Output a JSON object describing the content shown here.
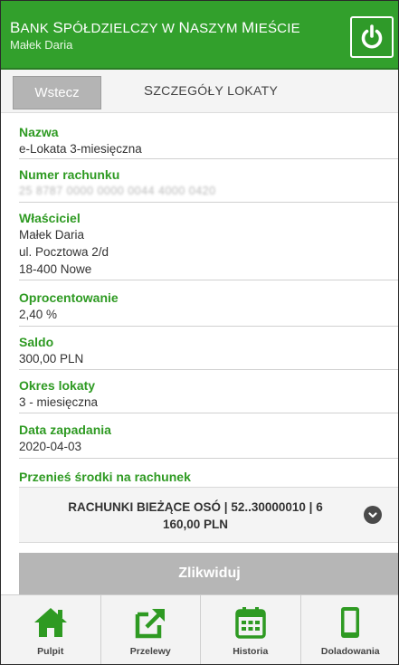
{
  "header": {
    "bank_name_first": "B",
    "bank_name_rest": "ANK",
    "bank_name_second": "S",
    "bank_name_second_rest": "PÓŁDZIELCZY W",
    "bank_name_third": "N",
    "bank_name_third_rest": "ASZYM",
    "bank_name_fourth": "M",
    "bank_name_fourth_rest": "IEŚCIE",
    "user_name": "Małek Daria",
    "power_icon": "power-icon"
  },
  "toolbar": {
    "back_label": "Wstecz",
    "title_first": "S",
    "title_rest": "ZCZEGÓŁY LOKATY"
  },
  "details": {
    "name": {
      "label": "Nazwa",
      "value": "e-Lokata 3-miesięczna"
    },
    "account_number": {
      "label": "Numer rachunku",
      "value": "25 8787 0000 0000 0044 4000 0420"
    },
    "owner": {
      "label": "Właściciel",
      "line1": "Małek Daria",
      "line2": "ul. Pocztowa 2/d",
      "line3": "18-400 Nowe"
    },
    "interest": {
      "label": "Oprocentowanie",
      "value": "2,40 %"
    },
    "balance": {
      "label": "Saldo",
      "value": "300,00 PLN"
    },
    "period": {
      "label": "Okres lokaty",
      "value": "3 - miesięczna"
    },
    "maturity": {
      "label": "Data zapadania",
      "value": "2020-04-03"
    }
  },
  "transfer": {
    "label": "Przenieś środki na rachunek",
    "selected_line1": "RACHUNKI BIEŻĄCE OSÓ | 52..30000010 | 6",
    "selected_line2": "160,00 PLN",
    "chevron_icon": "chevron-down-icon"
  },
  "actions": {
    "liquidate_label": "Zlikwiduj"
  },
  "bottom_nav": {
    "items": [
      {
        "label": "Pulpit",
        "icon": "home-icon"
      },
      {
        "label": "Przelewy",
        "icon": "transfer-arrow-icon"
      },
      {
        "label": "Historia",
        "icon": "calendar-icon"
      },
      {
        "label": "Doladowania",
        "icon": "phone-icon"
      }
    ]
  },
  "colors": {
    "brand_green": "#32a02c",
    "label_green": "#2e9a22",
    "button_gray": "#b6b6b6"
  }
}
